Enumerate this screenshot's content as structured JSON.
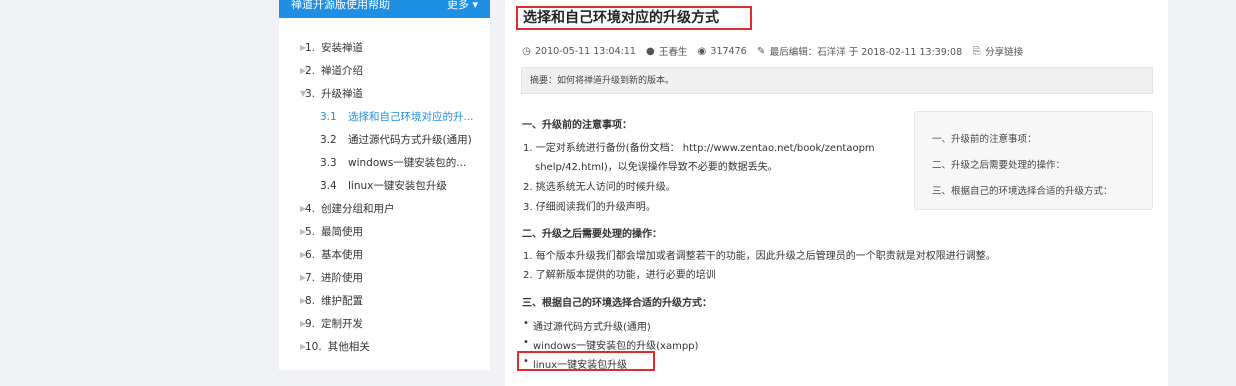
{
  "sidebar": {
    "header_title": "禅道开源版使用帮助",
    "header_more": "更多",
    "items": [
      {
        "num": "1.",
        "label": "安装禅道"
      },
      {
        "num": "2.",
        "label": "禅道介绍"
      },
      {
        "num": "3.",
        "label": "升级禅道"
      },
      {
        "num": "4.",
        "label": "创建分组和用户"
      },
      {
        "num": "5.",
        "label": "最简使用"
      },
      {
        "num": "6.",
        "label": "基本使用"
      },
      {
        "num": "7.",
        "label": "进阶使用"
      },
      {
        "num": "8.",
        "label": "维护配置"
      },
      {
        "num": "9.",
        "label": "定制开发"
      },
      {
        "num": "10.",
        "label": "其他相关"
      }
    ],
    "subitems": [
      {
        "num": "3.1",
        "label": "选择和自己环境对应的升..."
      },
      {
        "num": "3.2",
        "label": "通过源代码方式升级(通用)"
      },
      {
        "num": "3.3",
        "label": "windows一键安装包的..."
      },
      {
        "num": "3.4",
        "label": "linux一键安装包升级"
      }
    ]
  },
  "article": {
    "title": "选择和自己环境对应的升级方式",
    "date": "2010-05-11 13:04:11",
    "author": "王春生",
    "views": "317476",
    "last_edit": "最后编辑：石洋洋 于 2018-02-11 13:39:08",
    "share": "分享链接",
    "summary": "摘要：如何将禅道升级到新的版本。",
    "sec1_title": "一、升级前的注意事项：",
    "sec1_line1a": "1. 一定对系统进行备份(备份文档： http://www.zentao.net/book/zentaopm",
    "sec1_line1b": "shelp/42.html)，以免误操作导致不必要的数据丢失。",
    "sec1_line2": "2. 挑选系统无人访问的时候升级。",
    "sec1_line3": "3. 仔细阅读我们的升级声明。",
    "sec2_title": "二、升级之后需要处理的操作：",
    "sec2_line1": "1. 每个版本升级我们都会增加或者调整若干的功能，因此升级之后管理员的一个职责就是对权限进行调整。",
    "sec2_line2": "2. 了解新版本提供的功能，进行必要的培训",
    "sec3_title": "三、根据自己的环境选择合适的升级方式：",
    "sec3_items": [
      "通过源代码方式升级(通用)",
      "windows一键安装包的升级(xampp)",
      "linux一键安装包升级"
    ]
  },
  "toc_box": {
    "items": [
      "一、升级前的注意事项：",
      "二、升级之后需要处理的操作：",
      "三、根据自己的环境选择合适的升级方式："
    ]
  },
  "colors": {
    "accent": "#1f8fe3",
    "highlight_border": "#e32b2b"
  }
}
